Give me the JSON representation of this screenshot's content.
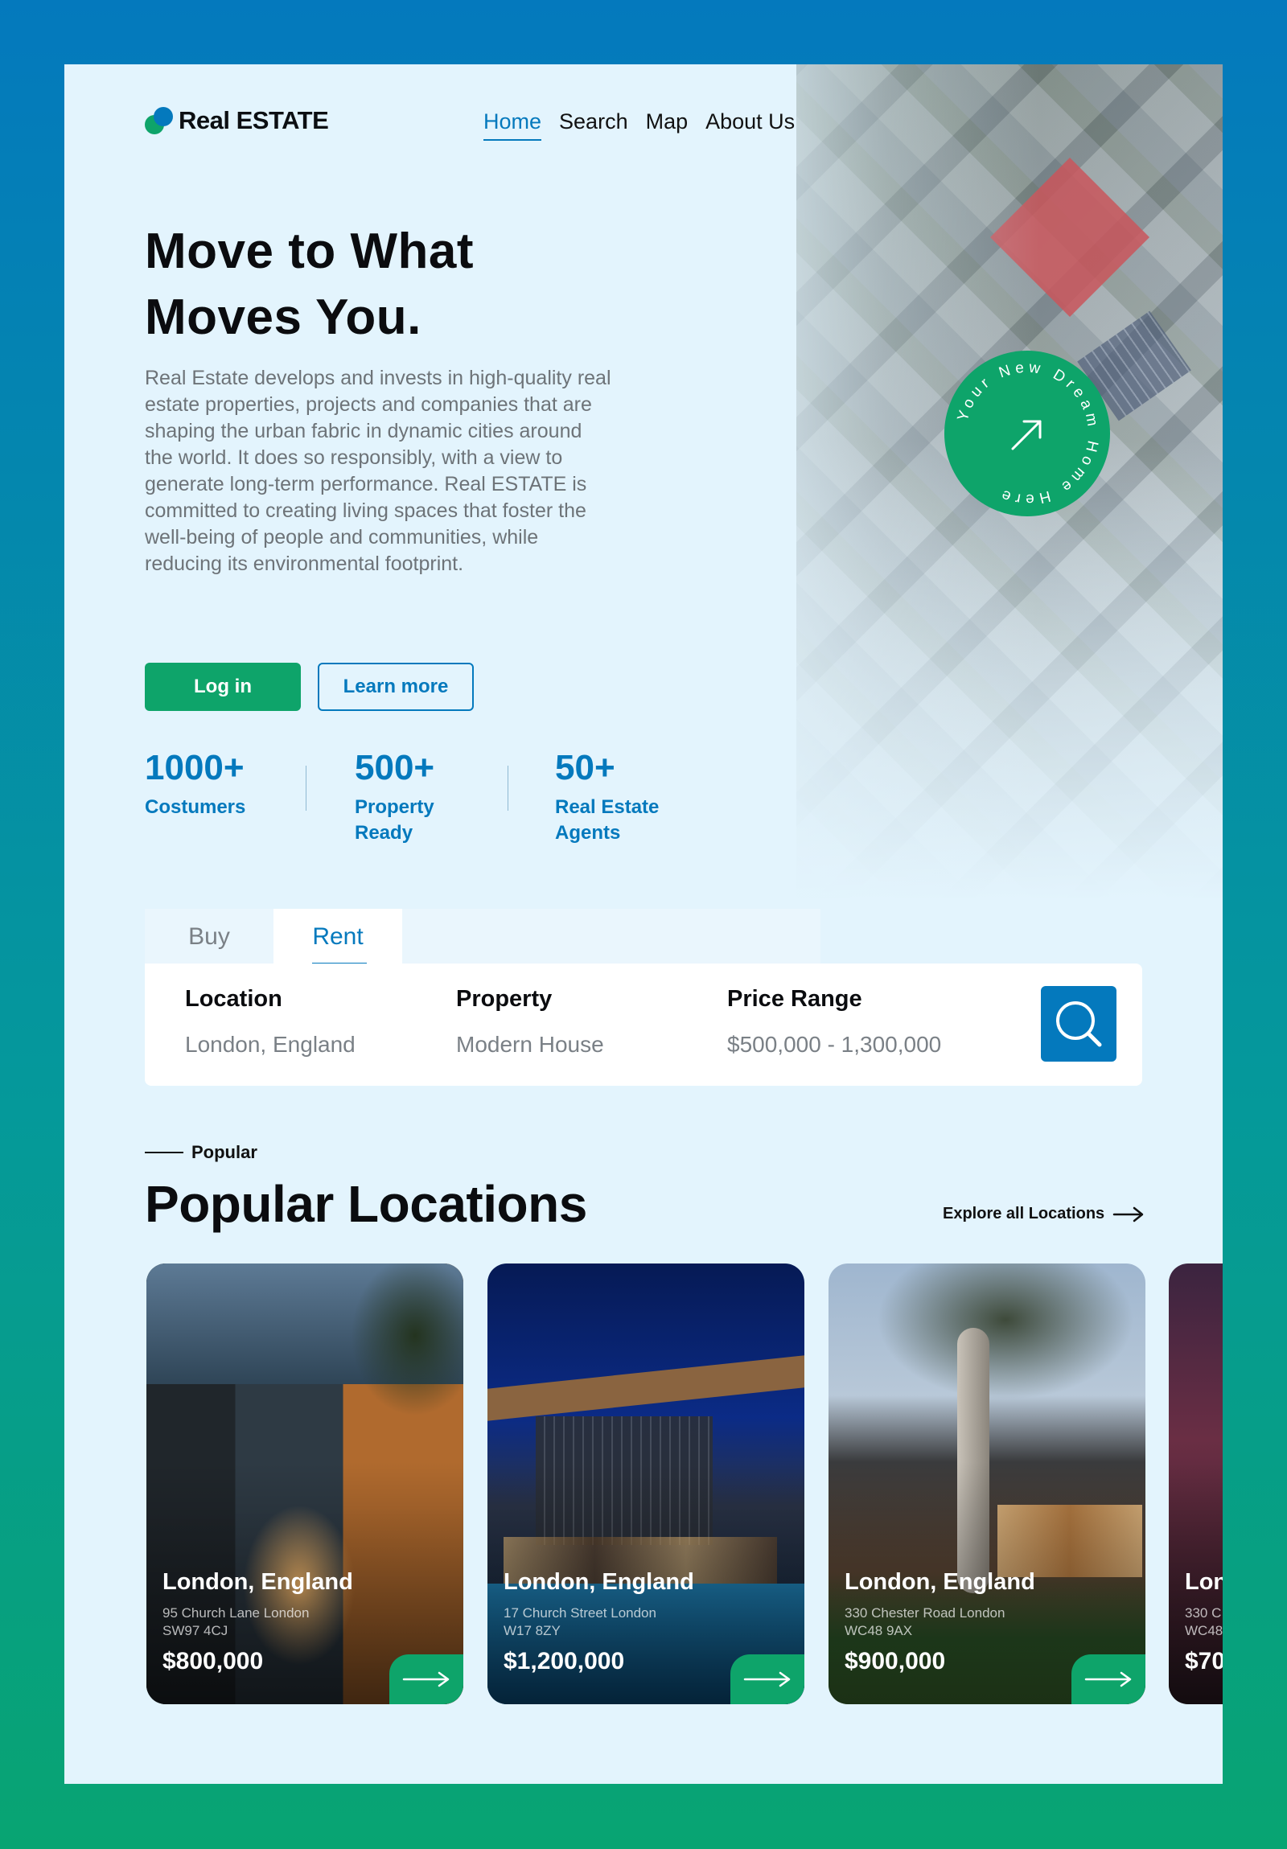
{
  "brand": {
    "name": "Real ESTATE",
    "colors": {
      "primary": "#0479bd",
      "accent": "#0ea46a"
    }
  },
  "nav": {
    "items": [
      "Home",
      "Search",
      "Map",
      "About Us"
    ],
    "active": "Home"
  },
  "hero": {
    "title_line1": "Move to What",
    "title_line2": "Moves You.",
    "description": "Real Estate develops and invests in high-quality real estate properties, projects and companies that are shaping the urban fabric in dynamic cities around the world. It does so responsibly, with a view to generate long-term performance. Real ESTATE is committed to creating living spaces that foster the well-being of people and communities, while reducing its environmental footprint.",
    "login_label": "Log in",
    "learn_label": "Learn more",
    "badge_text": "Your New Dream Home Here",
    "badge_icon": "arrow-up-right-icon"
  },
  "stats": [
    {
      "value": "1000+",
      "label_line1": "Costumers",
      "label_line2": ""
    },
    {
      "value": "500+",
      "label_line1": "Property",
      "label_line2": "Ready"
    },
    {
      "value": "50+",
      "label_line1": "Real Estate",
      "label_line2": "Agents"
    }
  ],
  "search": {
    "tabs": [
      "Buy",
      "Rent"
    ],
    "active_tab": "Rent",
    "fields": [
      {
        "label": "Location",
        "value": "London, England"
      },
      {
        "label": "Property",
        "value": "Modern House"
      },
      {
        "label": "Price Range",
        "value": "$500,000 - 1,300,000"
      }
    ],
    "button_icon": "search-icon"
  },
  "popular": {
    "kicker": "Popular",
    "title": "Popular Locations",
    "explore_label": "Explore all Locations",
    "cards": [
      {
        "city": "London, England",
        "address_line1": "95 Church Lane London",
        "address_line2": "SW97 4CJ",
        "price": "$800,000"
      },
      {
        "city": "London, England",
        "address_line1": "17 Church Street London",
        "address_line2": "W17 8ZY",
        "price": "$1,200,000"
      },
      {
        "city": "London, England",
        "address_line1": "330 Chester Road London",
        "address_line2": "WC48 9AX",
        "price": "$900,000"
      },
      {
        "city": "Lon",
        "address_line1": "330 C",
        "address_line2": "WC48",
        "price": "$70"
      }
    ]
  }
}
